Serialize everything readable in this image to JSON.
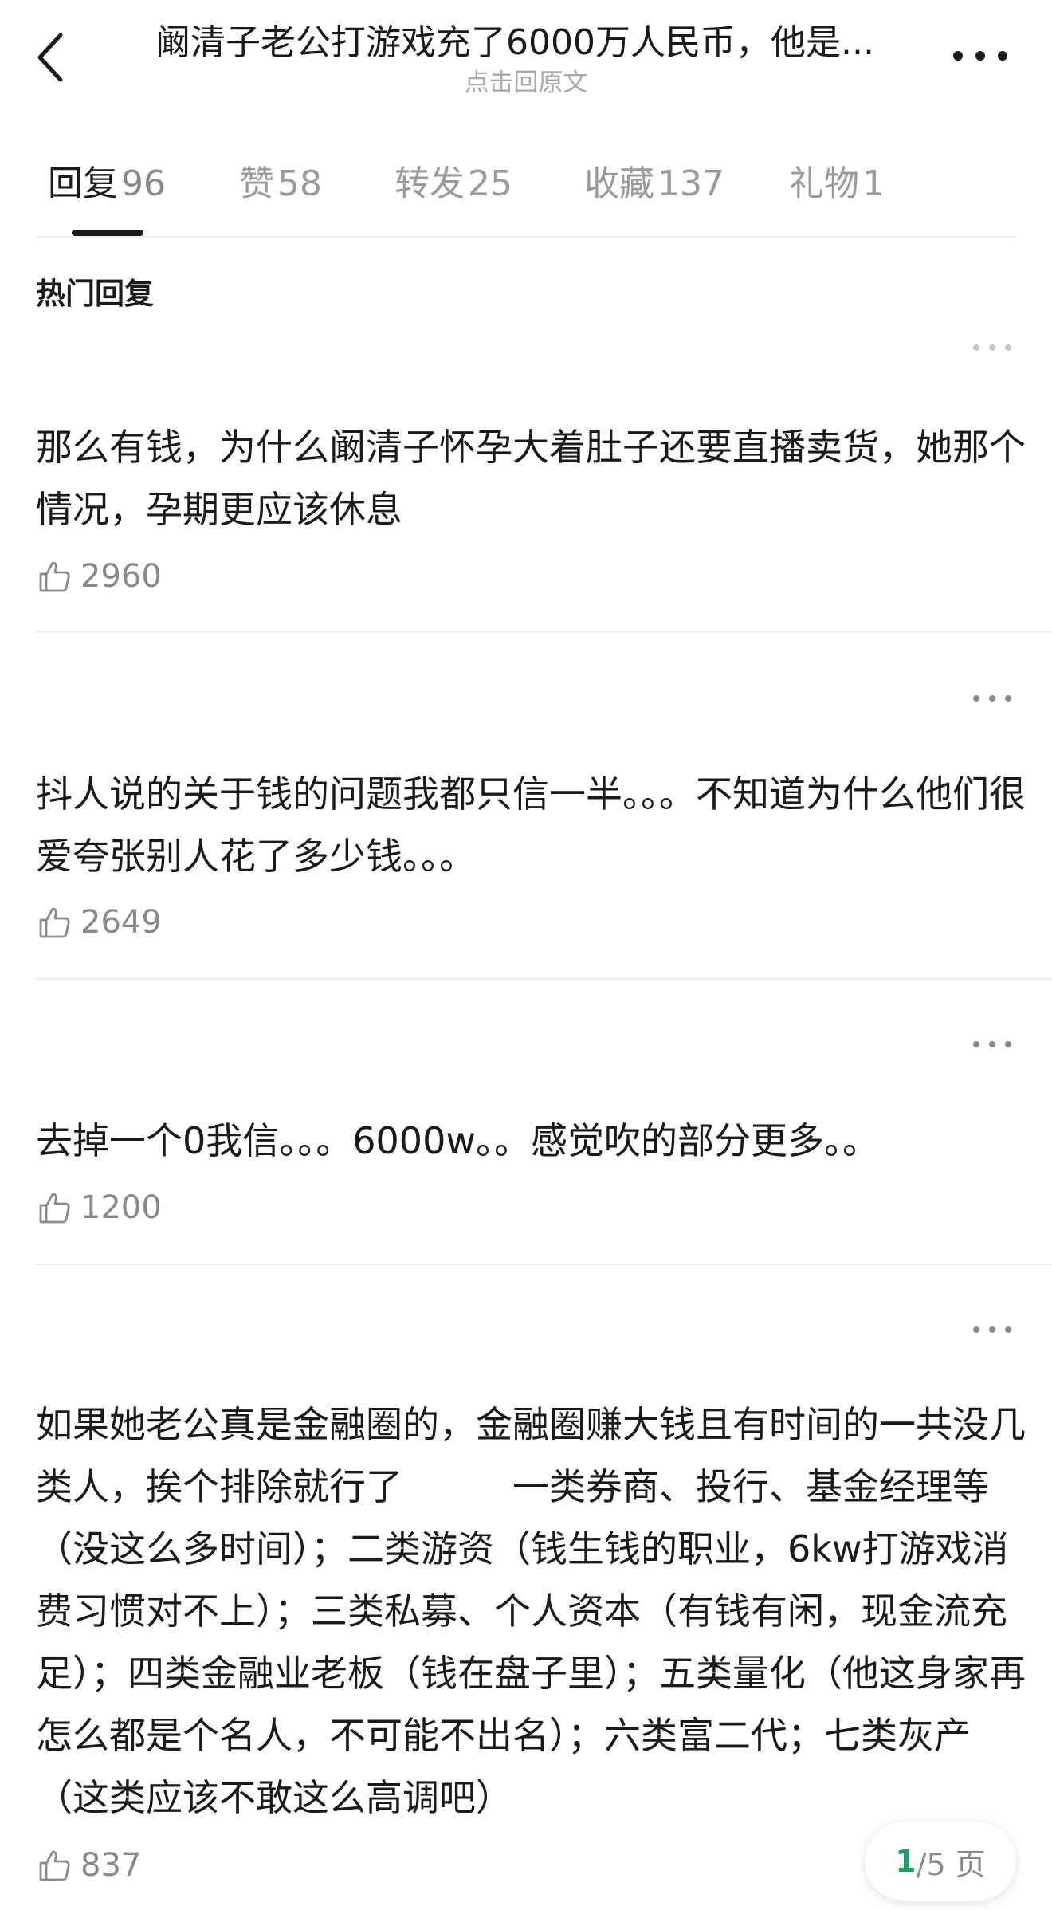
{
  "header": {
    "title": "阚清子老公打游戏充了6000万人民币，他是...",
    "subtitle": "点击回原文"
  },
  "tabs": [
    {
      "label": "回复",
      "count": "96"
    },
    {
      "label": "赞",
      "count": "58"
    },
    {
      "label": "转发",
      "count": "25"
    },
    {
      "label": "收藏",
      "count": "137"
    },
    {
      "label": "礼物",
      "count": "1"
    }
  ],
  "section": {
    "title": "热门回复"
  },
  "comments": [
    {
      "text": "那么有钱，为什么阚清子怀孕大着肚子还要直播卖货，她那个情况，孕期更应该休息",
      "likes": "2960"
    },
    {
      "text": "抖人说的关于钱的问题我都只信一半。。。不知道为什么他们很爱夸张别人花了多少钱。。。",
      "likes": "2649"
    },
    {
      "text": "去掉一个0我信。。。6000w。。感觉吹的部分更多。。",
      "likes": "1200"
    },
    {
      "text": "如果她老公真是金融圈的，金融圈赚大钱且有时间的一共没几类人，挨个排除就行了　　　一类券商、投行、基金经理等（没这么多时间）；二类游资（钱生钱的职业，6kw打游戏消费习惯对不上）；三类私募、个人资本（有钱有闲，现金流充足）；四类金融业老板（钱在盘子里）；五类量化（他这身家再怎么都是个名人，不可能不出名）；六类富二代；七类灰产（这类应该不敢这么高调吧）",
      "likes": "837"
    }
  ],
  "pager": {
    "current": "1",
    "total": "/5 页"
  },
  "colors": {
    "accent": "#1aa360",
    "muted": "#8a8a8a",
    "divider": "#ececec"
  }
}
